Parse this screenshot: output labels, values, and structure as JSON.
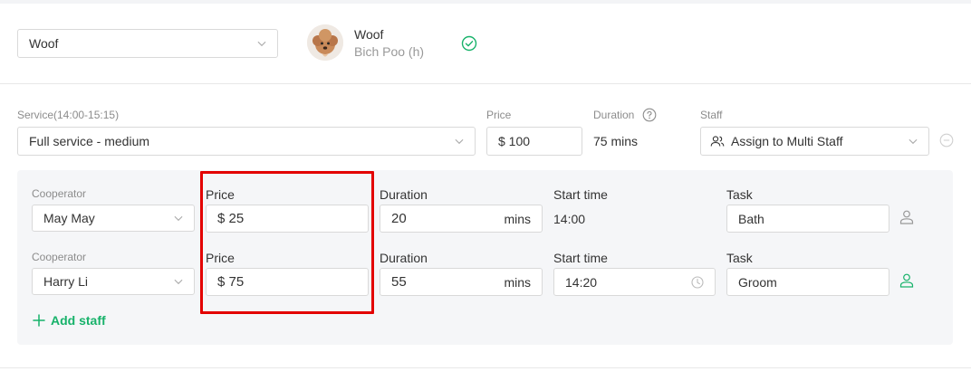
{
  "pet": {
    "select_value": "Woof",
    "name": "Woof",
    "breed": "Bich Poo (h)"
  },
  "service": {
    "label": "Service(14:00-15:15)",
    "value": "Full service - medium",
    "price_label": "Price",
    "price_value": "$ 100",
    "duration_label": "Duration",
    "duration_value": "75 mins",
    "staff_label": "Staff",
    "staff_value": "Assign to Multi Staff"
  },
  "cooperators": [
    {
      "cooperator_label": "Cooperator",
      "cooperator_value": "May May",
      "price_label": "Price",
      "price_value": "$ 25",
      "duration_label": "Duration",
      "duration_value": "20",
      "duration_unit": "mins",
      "start_label": "Start time",
      "start_value": "14:00",
      "task_label": "Task",
      "task_value": "Bath"
    },
    {
      "cooperator_label": "Cooperator",
      "cooperator_value": "Harry Li",
      "price_label": "Price",
      "price_value": "$ 75",
      "duration_label": "Duration",
      "duration_value": "55",
      "duration_unit": "mins",
      "start_label": "Start time",
      "start_value": "14:20",
      "task_label": "Task",
      "task_value": "Groom"
    }
  ],
  "add_staff_label": "Add staff",
  "colors": {
    "accent_green": "#17b26a",
    "highlight_red": "#e30000",
    "panel_bg": "#f5f6f8"
  }
}
